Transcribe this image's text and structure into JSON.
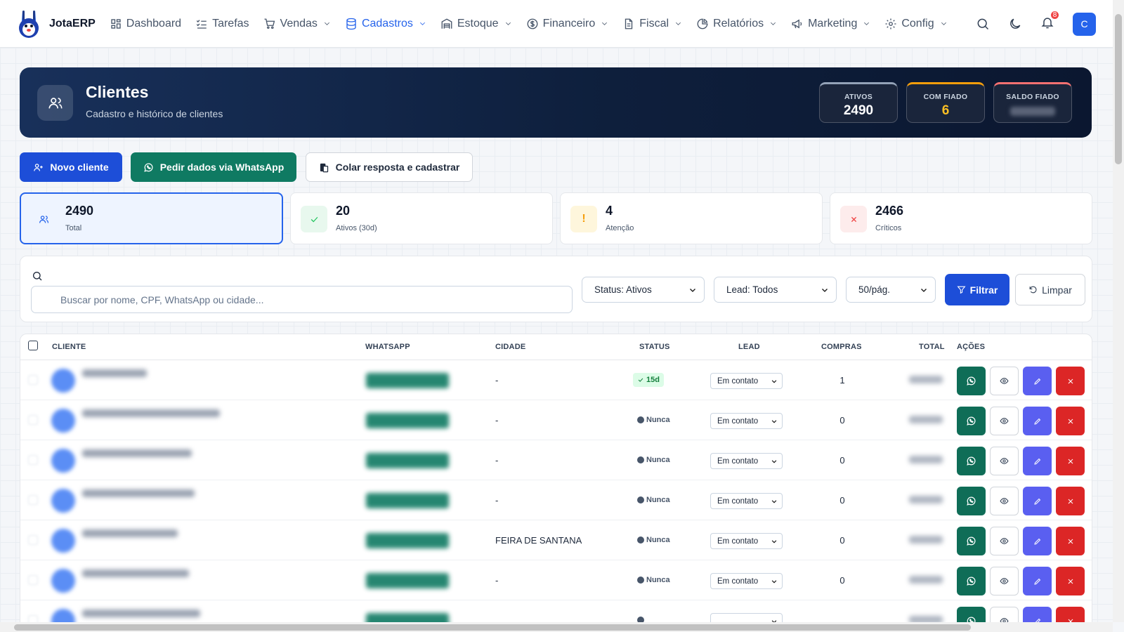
{
  "nav": {
    "brand": "JotaERP",
    "items": [
      {
        "label": "Dashboard",
        "icon": "grid-icon",
        "dropdown": false,
        "active": false
      },
      {
        "label": "Tarefas",
        "icon": "list-check-icon",
        "dropdown": false,
        "active": false
      },
      {
        "label": "Vendas",
        "icon": "cart-icon",
        "dropdown": true,
        "active": false
      },
      {
        "label": "Cadastros",
        "icon": "database-icon",
        "dropdown": true,
        "active": true
      },
      {
        "label": "Estoque",
        "icon": "warehouse-icon",
        "dropdown": true,
        "active": false
      },
      {
        "label": "Financeiro",
        "icon": "dollar-icon",
        "dropdown": true,
        "active": false
      },
      {
        "label": "Fiscal",
        "icon": "file-icon",
        "dropdown": true,
        "active": false
      },
      {
        "label": "Relatórios",
        "icon": "pie-chart-icon",
        "dropdown": true,
        "active": false
      },
      {
        "label": "Marketing",
        "icon": "megaphone-icon",
        "dropdown": true,
        "active": false
      },
      {
        "label": "Config",
        "icon": "gear-icon",
        "dropdown": true,
        "active": false
      }
    ],
    "notifications": "8",
    "user_initial": "C",
    "accent": "#2563eb"
  },
  "hero": {
    "title": "Clientes",
    "subtitle": "Cadastro e histórico de clientes",
    "kpis": [
      {
        "label": "ATIVOS",
        "value": "2490"
      },
      {
        "label": "COM FIADO",
        "value": "6"
      },
      {
        "label": "SALDO FIADO",
        "value": ""
      }
    ]
  },
  "actions": {
    "new_client": "Novo cliente",
    "whatsapp_request": "Pedir dados via WhatsApp",
    "paste_register": "Colar resposta e cadastrar"
  },
  "stats": [
    {
      "value": "2490",
      "label": "Total"
    },
    {
      "value": "20",
      "label": "Ativos (30d)"
    },
    {
      "value": "4",
      "label": "Atenção"
    },
    {
      "value": "2466",
      "label": "Críticos"
    }
  ],
  "filters": {
    "search_placeholder": "Buscar por nome, CPF, WhatsApp ou cidade...",
    "status": "Status: Ativos",
    "lead": "Lead: Todos",
    "per_page": "50/pág.",
    "filter_button": "Filtrar",
    "clear_button": "Limpar"
  },
  "table": {
    "headers": {
      "cliente": "CLIENTE",
      "whatsapp": "WHATSAPP",
      "cidade": "CIDADE",
      "status": "STATUS",
      "lead": "LEAD",
      "compras": "COMPRAS",
      "total": "TOTAL",
      "acoes": "AÇÕES"
    },
    "rows": [
      {
        "cidade": "-",
        "status": "15d",
        "status_type": "ok",
        "lead": "Em contato",
        "compras": "1"
      },
      {
        "cidade": "-",
        "status": "Nunca",
        "status_type": "never",
        "lead": "Em contato",
        "compras": "0"
      },
      {
        "cidade": "-",
        "status": "Nunca",
        "status_type": "never",
        "lead": "Em contato",
        "compras": "0"
      },
      {
        "cidade": "-",
        "status": "Nunca",
        "status_type": "never",
        "lead": "Em contato",
        "compras": "0"
      },
      {
        "cidade": "FEIRA DE SANTANA",
        "status": "Nunca",
        "status_type": "never",
        "lead": "Em contato",
        "compras": "0"
      },
      {
        "cidade": "-",
        "status": "Nunca",
        "status_type": "never",
        "lead": "Em contato",
        "compras": "0"
      },
      {
        "cidade": "",
        "status": "",
        "status_type": "never",
        "lead": "",
        "compras": ""
      }
    ]
  }
}
